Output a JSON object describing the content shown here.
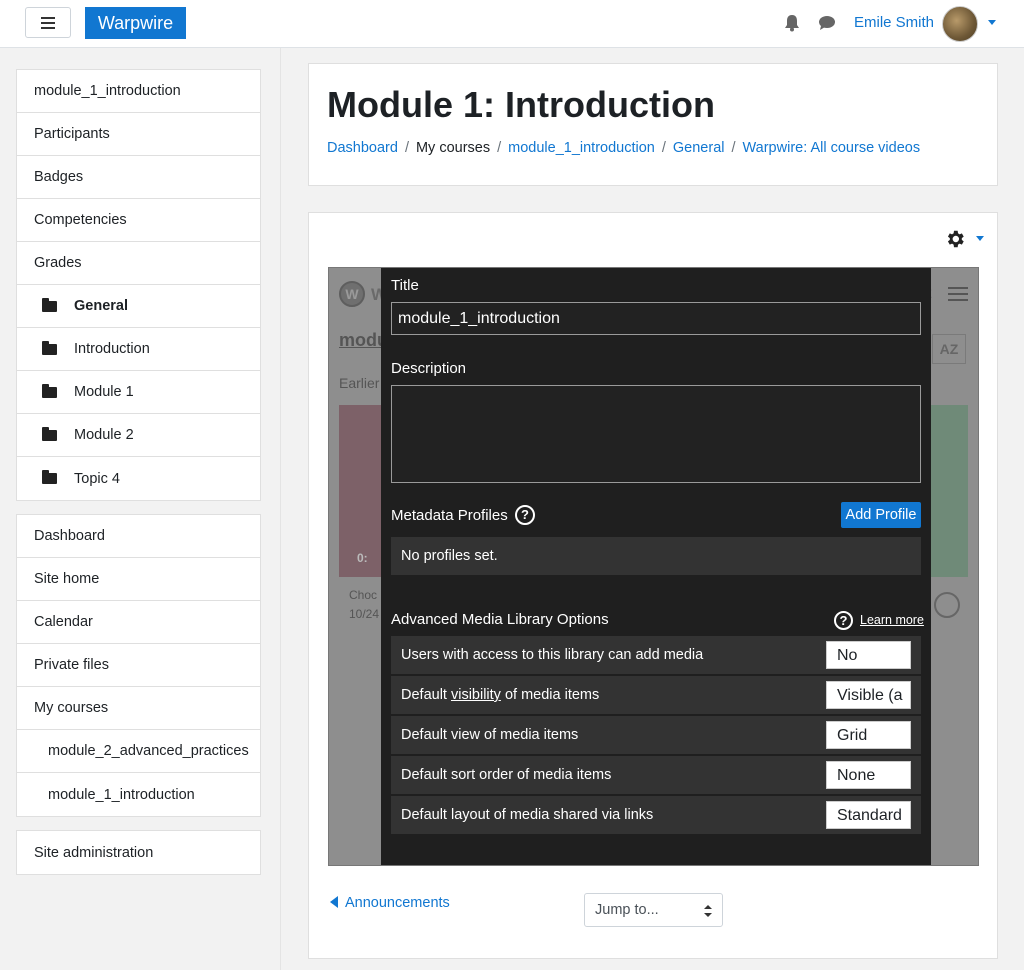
{
  "navbar": {
    "brand": "Warpwire",
    "user_name": "Emile Smith"
  },
  "drawer": {
    "course_items": [
      {
        "label": "module_1_introduction"
      },
      {
        "label": "Participants"
      },
      {
        "label": "Badges"
      },
      {
        "label": "Competencies"
      },
      {
        "label": "Grades"
      },
      {
        "label": "General"
      },
      {
        "label": "Introduction"
      },
      {
        "label": "Module 1"
      },
      {
        "label": "Module 2"
      },
      {
        "label": "Topic 4"
      }
    ],
    "site_items": [
      {
        "label": "Dashboard"
      },
      {
        "label": "Site home"
      },
      {
        "label": "Calendar"
      },
      {
        "label": "Private files"
      },
      {
        "label": "My courses"
      },
      {
        "label": "module_2_advanced_practices"
      },
      {
        "label": "module_1_introduction"
      }
    ],
    "admin_label": "Site administration"
  },
  "header": {
    "title": "Module 1: Introduction",
    "breadcrumb": [
      "Dashboard",
      "My courses",
      "module_1_introduction",
      "General",
      "Warpwire: All course videos"
    ]
  },
  "embed_bg": {
    "partial_title": "modu",
    "partial_earlier": "Earlier",
    "partial_w": "W",
    "partial_t": "t",
    "partial_time": "0:",
    "partial_caption1": "Choc",
    "partial_caption2": "10/24",
    "logo_letter": "W",
    "az_label": "AZ"
  },
  "modal": {
    "title_label": "Title",
    "title_value": "module_1_introduction",
    "description_label": "Description",
    "description_value": "",
    "metadata_label": "Metadata Profiles",
    "help_glyph": "?",
    "add_profile_label": "Add Profile",
    "no_profiles_text": "No profiles set.",
    "advanced_label": "Advanced Media Library Options",
    "learn_more_label": "Learn more",
    "options": [
      {
        "label": "Users with access to this library can add media",
        "value": "No"
      },
      {
        "label_before": "Default ",
        "label_underlined": "visibility",
        "label_after": " of media items",
        "value": "Visible (a"
      },
      {
        "label": "Default view of media items",
        "value": "Grid"
      },
      {
        "label": "Default sort order of media items",
        "value": "None"
      },
      {
        "label": "Default layout of media shared via links",
        "value": "Standard"
      }
    ]
  },
  "footer": {
    "prev_label": "Announcements",
    "jump_label": "Jump to..."
  },
  "colors": {
    "brand": "#1177d1",
    "modal_bg": "#1f1f1f",
    "row_bg": "#333333"
  }
}
